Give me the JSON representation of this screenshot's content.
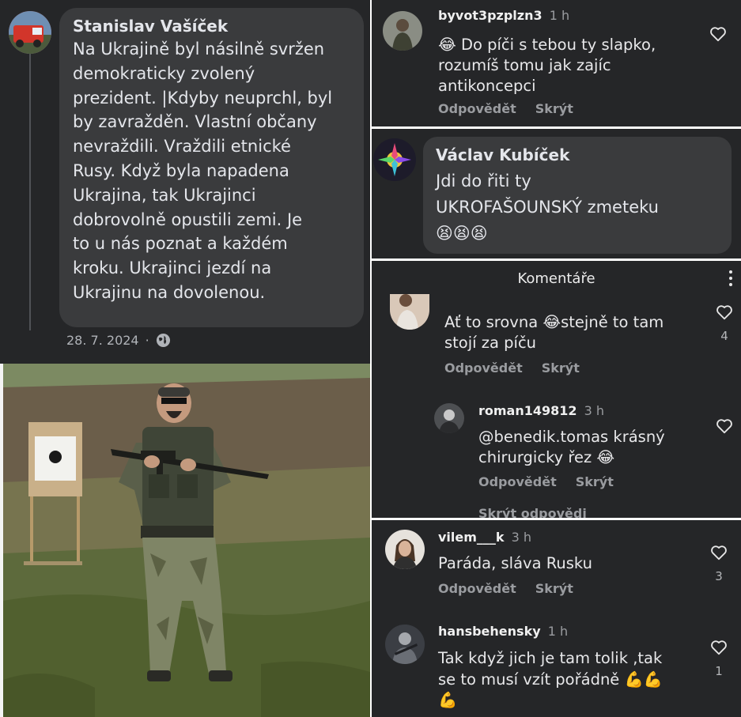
{
  "fb_post": {
    "author": "Stanislav Vašíček",
    "text": "Na Ukrajině byl násilně svržen\ndemokraticky zvolený\nprezident. |Kdyby neuprchl, byl\nby zavražděn. Vlastní občany\nnevraždili. Vraždili etnické\nRusy. Když byla napadena\nUkrajina, tak Ukrajinci\ndobrovolně opustili zemi. Je\nto u nás poznat a každém\nkroku. Ukrajinci jezdí na\nUkrajinu na dovolenou.",
    "date": "28. 7. 2024",
    "separator": "·",
    "audience_icon": "globe-icon"
  },
  "comment_1": {
    "username": "byvot3pzplzn3",
    "time": "1 h",
    "text": "😂 Do píči s tebou ty slapko,\nrozumíš tomu jak zajíc\nantikoncepci",
    "reply": "Odpovědět",
    "hide": "Skrýt"
  },
  "comment_2": {
    "author": "Václav Kubíček",
    "text": "Jdi do řiti ty\nUKROFAŠOUNSKÝ zmeteku\n😫😫😫"
  },
  "comments_panel": {
    "title": "Komentáře",
    "items": [
      {
        "text": "Ať to srovna 😂stejně to tam\nstojí za píču",
        "likes": "4",
        "reply": "Odpovědět",
        "hide": "Skrýt"
      },
      {
        "username": "roman149812",
        "time": "3 h",
        "text": "@benedik.tomas krásný\nchirurgicky řez 😂",
        "reply": "Odpovědět",
        "hide": "Skrýt",
        "hide_replies": "Skrýt odpovědi"
      }
    ]
  },
  "comments_bottom": {
    "items": [
      {
        "username": "vilem___k",
        "time": "3 h",
        "text": "Paráda, sláva Rusku",
        "likes": "3",
        "reply": "Odpovědět",
        "hide": "Skrýt"
      },
      {
        "username": "hansbehensky",
        "time": "1 h",
        "text": "Tak když jich je tam tolik ,tak\nse to musí vzít pořádně 💪💪\n💪",
        "likes": "1"
      }
    ]
  },
  "icons": {
    "heart": "heart-outline-icon",
    "more": "more-vertical-icon"
  },
  "colors": {
    "dark_bg": "#252628",
    "bubble_bg": "#3a3b3d",
    "text_primary": "#e4e6eb",
    "text_secondary": "#9a9ca0"
  }
}
